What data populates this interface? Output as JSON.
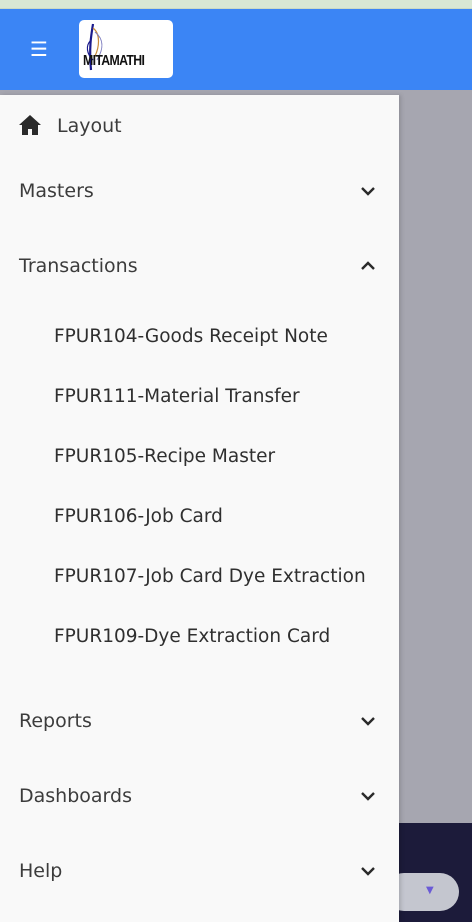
{
  "header": {
    "logo_text": "MITAMATHI",
    "brand_color": "#3b85f5"
  },
  "drawer": {
    "layout": {
      "label": "Layout",
      "icon": "home-icon"
    },
    "sections": [
      {
        "label": "Masters",
        "expanded": false
      },
      {
        "label": "Transactions",
        "expanded": true
      },
      {
        "label": "Reports",
        "expanded": false
      },
      {
        "label": "Dashboards",
        "expanded": false
      },
      {
        "label": "Help",
        "expanded": false
      }
    ],
    "transactions_items": [
      "FPUR104-Goods Receipt Note",
      "FPUR111-Material Transfer",
      "FPUR105-Recipe Master",
      "FPUR106-Job Card",
      "FPUR107-Job Card Dye Extraction",
      "FPUR109-Dye Extraction Card"
    ]
  }
}
